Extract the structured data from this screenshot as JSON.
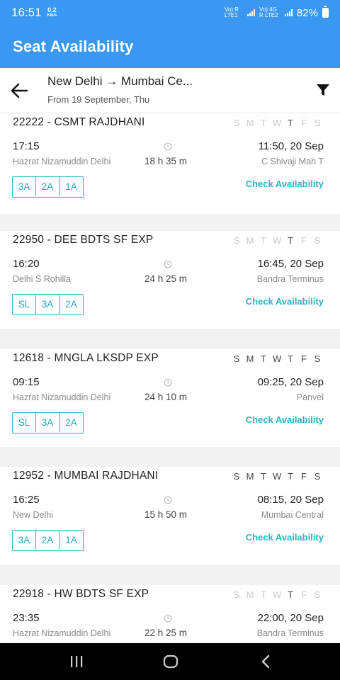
{
  "status_bar": {
    "time": "16:51",
    "speed_value": "0.2",
    "speed_unit": "KB/s",
    "net1": "Vo) R LTE1",
    "net2": "Vo) 4G R LTE2",
    "battery": "82%"
  },
  "app_bar": {
    "title": "Seat Availability"
  },
  "route": {
    "title": "New Delhi → Mumbai Ce...",
    "subtitle": "From 19 September, Thu"
  },
  "days_labels": [
    "S",
    "M",
    "T",
    "W",
    "T",
    "F",
    "S"
  ],
  "check_label": "Check Availability",
  "trains": [
    {
      "name": "22222 - CSMT RAJDHANI",
      "runs": [
        false,
        false,
        false,
        false,
        true,
        false,
        false
      ],
      "dep_time": "17:15",
      "dep_station": "Hazrat Nizamuddin Delhi",
      "duration": "18 h 35 m",
      "arr_time": "11:50, 20 Sep",
      "arr_station": "C Shivaji Mah T",
      "classes": [
        "3A",
        "2A",
        "1A"
      ]
    },
    {
      "name": "22950 - DEE BDTS SF EXP",
      "runs": [
        false,
        false,
        false,
        false,
        true,
        false,
        false
      ],
      "dep_time": "16:20",
      "dep_station": "Delhi S Rohilla",
      "duration": "24 h 25 m",
      "arr_time": "16:45, 20 Sep",
      "arr_station": "Bandra Terminus",
      "classes": [
        "SL",
        "3A",
        "2A"
      ]
    },
    {
      "name": "12618 - MNGLA LKSDP EXP",
      "runs": [
        true,
        true,
        true,
        true,
        true,
        true,
        true
      ],
      "dep_time": "09:15",
      "dep_station": "Hazrat Nizamuddin Delhi",
      "duration": "24 h 10 m",
      "arr_time": "09:25, 20 Sep",
      "arr_station": "Panvel",
      "classes": [
        "SL",
        "3A",
        "2A"
      ]
    },
    {
      "name": "12952 - MUMBAI RAJDHANI",
      "runs": [
        true,
        true,
        true,
        true,
        true,
        true,
        true
      ],
      "dep_time": "16:25",
      "dep_station": "New Delhi",
      "duration": "15 h 50 m",
      "arr_time": "08:15, 20 Sep",
      "arr_station": "Mumbai Central",
      "classes": [
        "3A",
        "2A",
        "1A"
      ]
    },
    {
      "name": "22918 - HW BDTS SF EXP",
      "runs": [
        false,
        false,
        false,
        false,
        true,
        false,
        false
      ],
      "dep_time": "23:35",
      "dep_station": "Hazrat Nizamuddin Delhi",
      "duration": "22 h 25 m",
      "arr_time": "22:00, 20 Sep",
      "arr_station": "Bandra Terminus",
      "classes": []
    }
  ],
  "icons": {
    "back": "arrow-left-icon",
    "filter": "funnel-icon",
    "clock": "clock-icon",
    "nav_recents": "recents-icon",
    "nav_home": "home-icon",
    "nav_back": "back-chevron-icon"
  },
  "colors": {
    "primary": "#3a98f0",
    "accent": "#2ab5c2"
  }
}
